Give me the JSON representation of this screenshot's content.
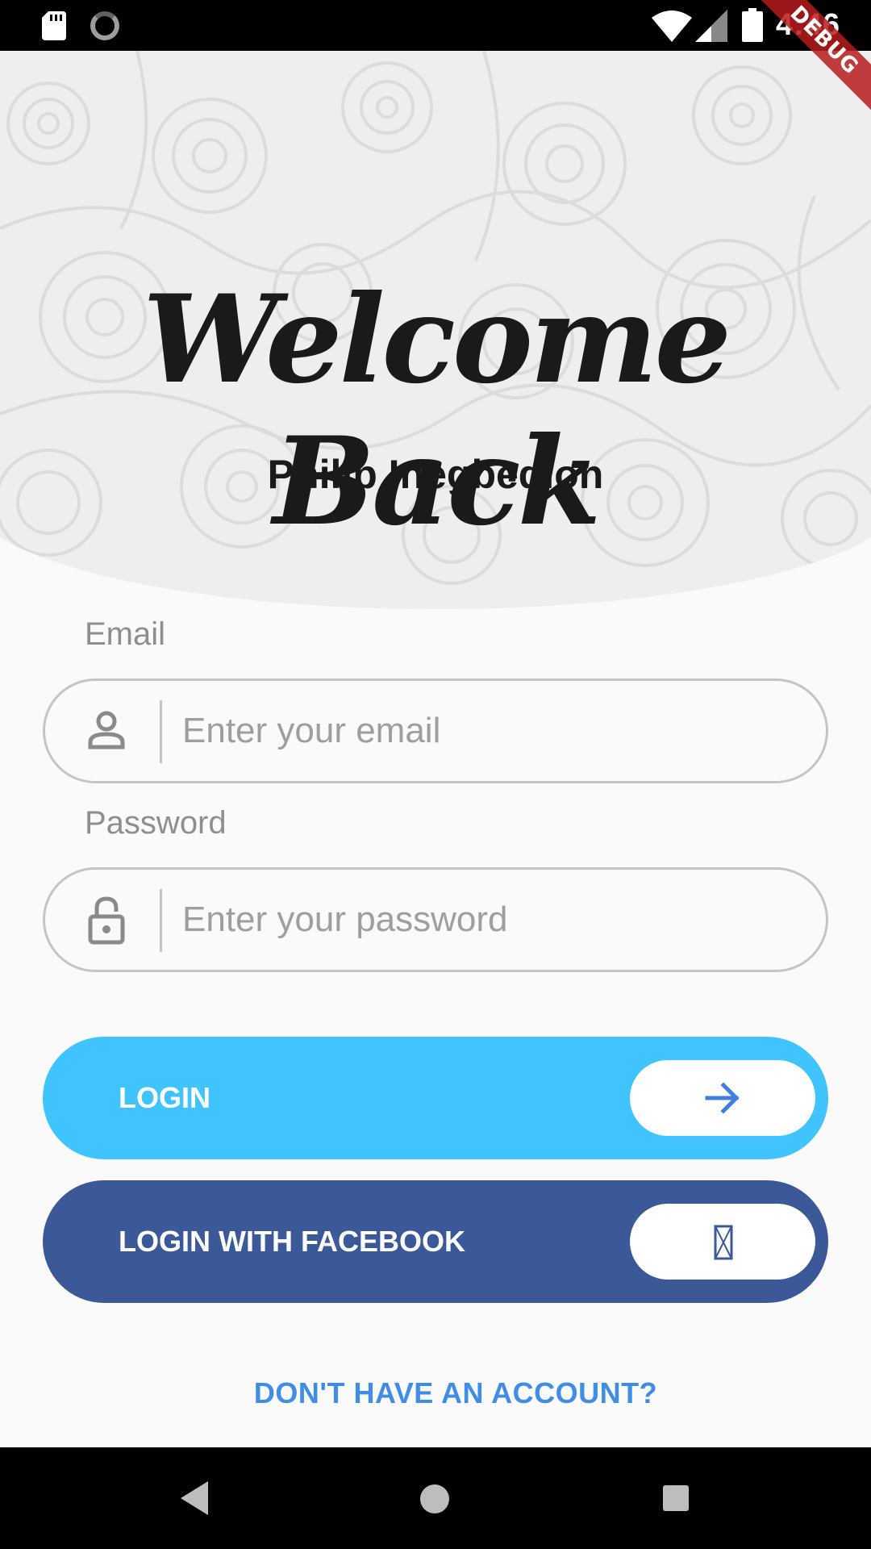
{
  "status_bar": {
    "time": "4:46"
  },
  "debug_banner": {
    "label": "DEBUG"
  },
  "header": {
    "title": "Welcome Back",
    "subtitle": "Philip Inegbedion"
  },
  "form": {
    "email": {
      "label": "Email",
      "placeholder": "Enter your email",
      "icon": "person-icon"
    },
    "password": {
      "label": "Password",
      "placeholder": "Enter your password",
      "icon": "lock-icon"
    }
  },
  "buttons": {
    "login": {
      "label": "LOGIN",
      "icon": "arrow-right-icon",
      "color": "#40c4ff"
    },
    "facebook": {
      "label": "LOGIN WITH FACEBOOK",
      "icon": "missing-glyph-icon",
      "color": "#3b5998"
    }
  },
  "signup": {
    "label": "DON'T HAVE AN ACCOUNT?"
  },
  "nav_bar": {
    "icons": [
      "back-icon",
      "home-icon",
      "recents-icon"
    ]
  }
}
